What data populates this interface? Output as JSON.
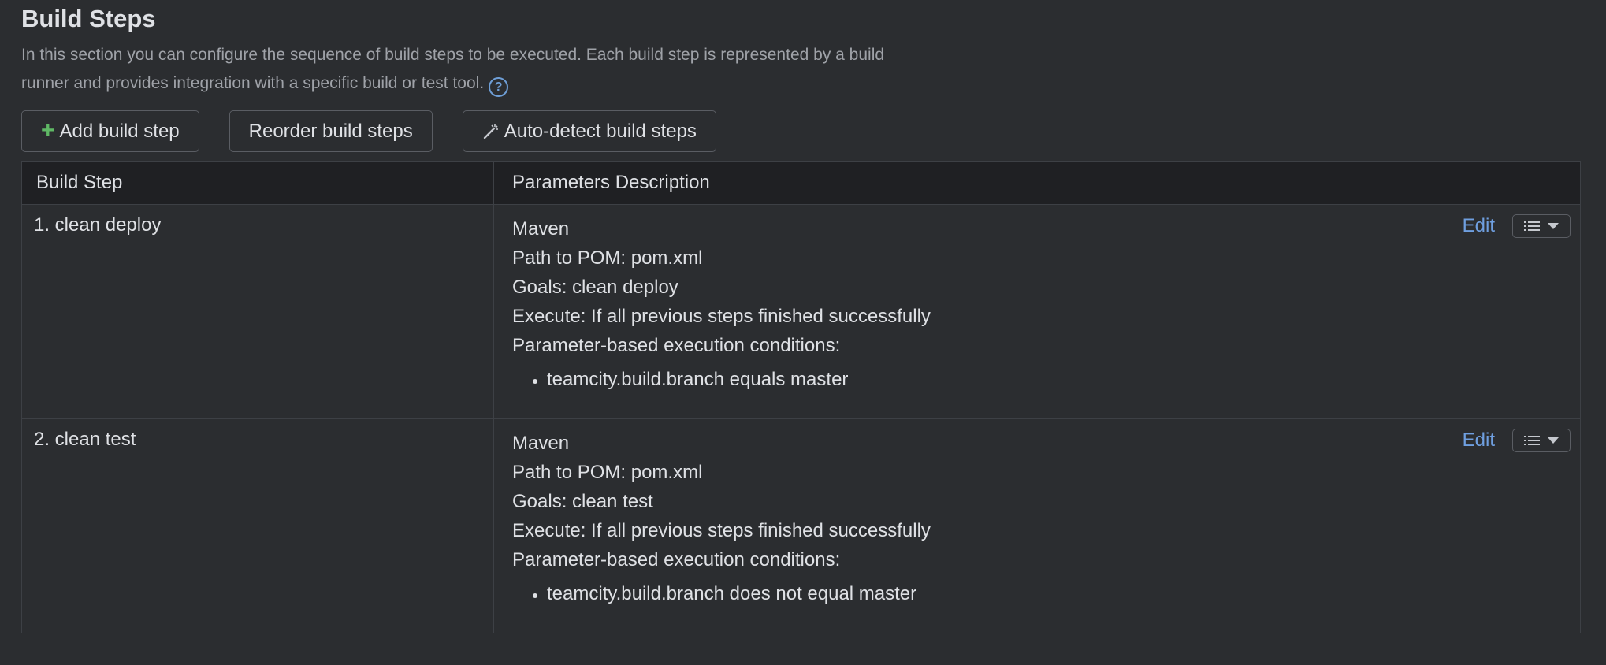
{
  "section": {
    "title": "Build Steps",
    "description": "In this section you can configure the sequence of build steps to be executed. Each build step is represented by a build runner and provides integration with a specific build or test tool."
  },
  "toolbar": {
    "add_label": "Add build step",
    "reorder_label": "Reorder build steps",
    "autodetect_label": "Auto-detect build steps"
  },
  "table": {
    "headers": [
      "Build Step",
      "Parameters Description"
    ],
    "rows": [
      {
        "name": "1. clean deploy",
        "runner": "Maven",
        "pom": "Path to POM: pom.xml",
        "goals": "Goals: clean deploy",
        "execute": "Execute: If all previous steps finished successfully",
        "conditions_label": "Parameter-based execution conditions:",
        "conditions": [
          "teamcity.build.branch equals master"
        ],
        "edit_label": "Edit"
      },
      {
        "name": "2. clean test",
        "runner": "Maven",
        "pom": "Path to POM: pom.xml",
        "goals": "Goals: clean test",
        "execute": "Execute: If all previous steps finished successfully",
        "conditions_label": "Parameter-based execution conditions:",
        "conditions": [
          "teamcity.build.branch does not equal master"
        ],
        "edit_label": "Edit"
      }
    ]
  },
  "icons": {
    "help": "question-circle-icon",
    "add": "plus-icon",
    "autodetect": "magic-wand-icon",
    "row_menu": "list-icon",
    "dropdown": "caret-down-icon"
  },
  "colors": {
    "background": "#2b2d30",
    "header_bg": "#1f2023",
    "link": "#6f9fe0",
    "add_icon": "#5fb865"
  }
}
